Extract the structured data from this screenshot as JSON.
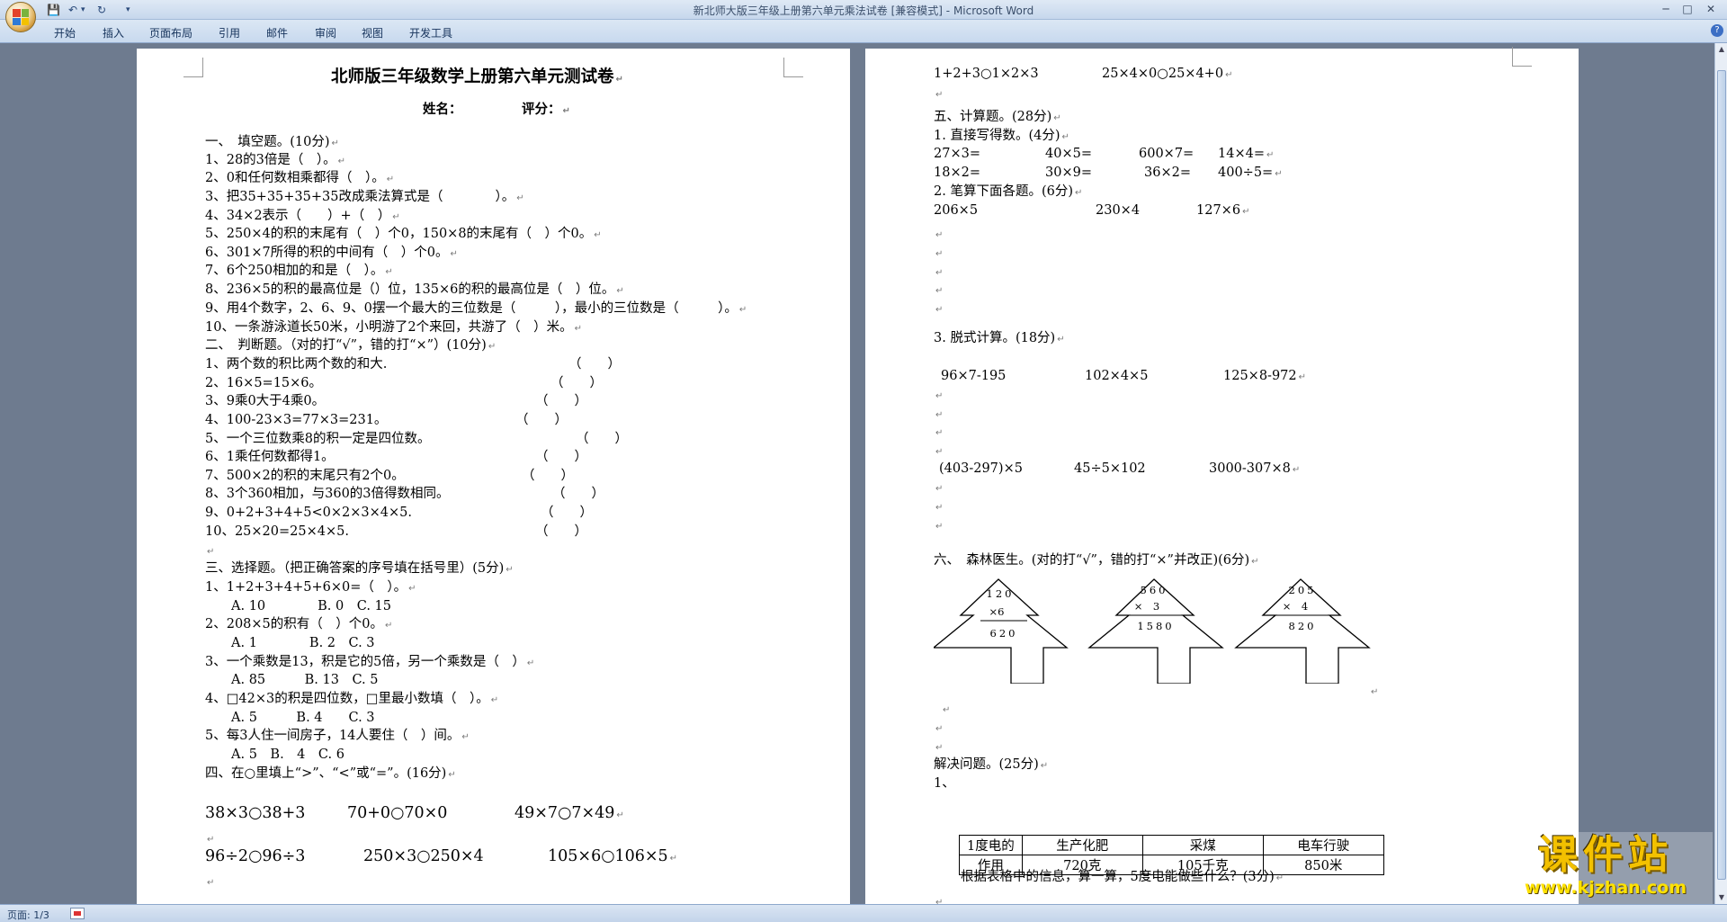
{
  "window": {
    "title": "新北师大版三年级上册第六单元乘法试卷 [兼容模式]",
    "separator": " - ",
    "app_name": "Microsoft Word",
    "minimize": "─",
    "maximize": "□",
    "close": "✕"
  },
  "qat": {
    "save": "💾",
    "undo": "↶",
    "undo_drop": "▾",
    "redo": "↻",
    "customize": "▾"
  },
  "ribbon": {
    "tabs": [
      "开始",
      "插入",
      "页面布局",
      "引用",
      "邮件",
      "审阅",
      "视图",
      "开发工具"
    ],
    "help": "?"
  },
  "doc": {
    "mark": "↵",
    "page1": {
      "title": "北师版三年级数学上册第六单元测试卷",
      "name_label": "姓名：",
      "score_label": "评分：",
      "s1_head": "一、　填空题。(10分)",
      "s1": [
        "1、28的3倍是（　）。",
        "2、0和任何数相乘都得（　）。",
        "3、把35+35+35+35改成乘法算式是（　　　　）。",
        "4、34×2表示（　　）+（　）",
        "5、250×4的积的末尾有（　）个0，150×8的末尾有（　）个0。",
        "6、301×7所得的积的中间有（　）个0。",
        "7、6个250相加的和是（　）。",
        "8、236×5的积的最高位是（）位，135×6的积的最高位是（　）位。",
        "9、用4个数字，2、6、9、0摆一个最大的三位数是（　　　），最小的三位数是（　　　）。",
        "10、一条游泳道长50米，小明游了2个来回，共游了（　）米。"
      ],
      "s2_head": "二、　判断题。（对的打“√”，错的打“×”）(10分)",
      "s2": [
        {
          "text": "1、两个数的积比两个数的和大.",
          "paren": "（　　）"
        },
        {
          "text": "2、16×5=15×6。",
          "paren": "（　　）"
        },
        {
          "text": "3、9乘0大于4乘0。",
          "paren": "（　　）"
        },
        {
          "text": "4、100-23×3=77×3=231。",
          "paren": "（　　）"
        },
        {
          "text": "5、一个三位数乘8的积一定是四位数。",
          "paren": "（　　）"
        },
        {
          "text": "6、1乘任何数都得1。",
          "paren": "（　　）"
        },
        {
          "text": "7、500×2的积的末尾只有2个0。",
          "paren": "（　　）"
        },
        {
          "text": "8、3个360相加，与360的3倍得数相同。",
          "paren": "（　　）"
        },
        {
          "text": "9、0+2+3+4+5<0×2×3×4×5.",
          "paren": "（　　）"
        },
        {
          "text": "10、25×20=25×4×5.",
          "paren": "（　　）"
        }
      ],
      "s3_head": "三、选择题。（把正确答案的序号填在括号里）(5分)",
      "s3": [
        "1、1+2+3+4+5+6×0=（　）。",
        "　　A. 10　　　　B. 0　C. 15",
        "2、208×5的积有（　）个0。",
        "　　A. 1　　　　B. 2　C. 3",
        "3、一个乘数是13，积是它的5倍，另一个乘数是（　）",
        "　　A. 85　　　B. 13　C. 5",
        "4、□42×3的积是四位数，□里最小数填（　）。",
        "　　A. 5　　　B. 4　　C. 3",
        "5、每3人住一间房子，14人要住（　）间。",
        "　　A. 5　B.　4　C. 6"
      ],
      "s4_head": "四、在○里填上“>”、“<”或“=”。(16分)",
      "s4_row1": [
        "38×3○38+3",
        "70+0○70×0",
        "49×7○7×49"
      ],
      "s4_row2": [
        "96÷2○96÷3",
        "250×3○250×4",
        "105×6○106×5"
      ]
    },
    "page2": {
      "top_row": [
        "1+2+3○1×2×3",
        "25×4×0○25×4+0"
      ],
      "s5_head": "五、计算题。(28分)",
      "s5_1_head": "1. 直接写得数。(4分)",
      "s5_1_row1": [
        "27×3=",
        "40×5=",
        "600×7=",
        "14×4="
      ],
      "s5_1_row2": [
        "18×2=",
        "30×9=",
        "36×2=",
        "400÷5="
      ],
      "s5_2_head": "2. 笔算下面各题。(6分)",
      "s5_2_row": [
        "206×5",
        "230×4",
        "127×6"
      ],
      "s5_3_head": "3. 脱式计算。(18分)",
      "s5_3_row1": [
        "96×7-195",
        "102×4×5",
        "125×8-972"
      ],
      "s5_3_row2": [
        "(403-297)×5",
        "45÷5×102",
        "3000-307×8"
      ],
      "s6_head": "六、　森林医生。(对的打“√”，错的打“×”并改正)(6分)",
      "trees": [
        {
          "top": "120",
          "mul": "×6",
          "result": "620"
        },
        {
          "top": "560",
          "mul": "×　3",
          "result": "1580"
        },
        {
          "top": "205",
          "mul": "×　4",
          "result": "820"
        }
      ],
      "s7_head": "解决问题。(25分)",
      "s7_1": "1、",
      "table_rows": [
        [
          "1度电的",
          "生产化肥",
          "采煤",
          "电车行驶"
        ],
        [
          "作用",
          "720克",
          "105千克",
          "850米"
        ]
      ],
      "s7_1_question": "根据表格中的信息，算一算，5度电能做些什么？(3分)"
    }
  },
  "status": {
    "page": "页面: 1/3"
  },
  "watermark": {
    "big": "课件站",
    "url": "www.kjzhan.com"
  }
}
